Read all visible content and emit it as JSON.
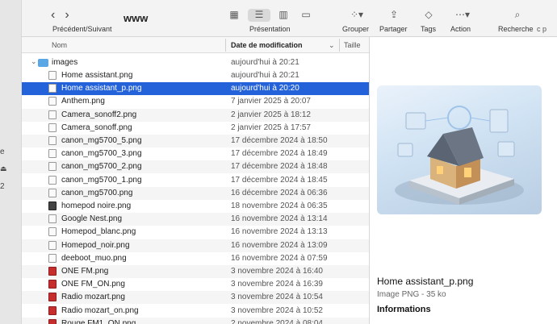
{
  "window_title": "www",
  "sidebar_fragments": [
    "e",
    "2"
  ],
  "toolbar": {
    "nav_label": "Précédent/Suivant",
    "back_glyph": "‹",
    "forward_glyph": "›",
    "view_label": "Présentation",
    "group_label": "Grouper",
    "share_label": "Partager",
    "tags_label": "Tags",
    "action_label": "Action",
    "search_label": "Recherche",
    "cut_label": "c p"
  },
  "columns": {
    "name": "Nom",
    "date": "Date de modification",
    "size": "Taille"
  },
  "folder": {
    "name": "images",
    "date": "aujourd'hui à 20:21"
  },
  "files": [
    {
      "name": "Home assistant.png",
      "date": "aujourd'hui à 20:21",
      "icon": "image"
    },
    {
      "name": "Home assistant_p.png",
      "date": "aujourd'hui à 20:20",
      "icon": "image",
      "selected": true
    },
    {
      "name": "Anthem.png",
      "date": "7 janvier 2025 à 20:07",
      "icon": "image"
    },
    {
      "name": "Camera_sonoff2.png",
      "date": "2 janvier 2025 à 18:12",
      "icon": "image"
    },
    {
      "name": "Camera_sonoff.png",
      "date": "2 janvier 2025 à 17:57",
      "icon": "image"
    },
    {
      "name": "canon_mg5700_5.png",
      "date": "17 décembre 2024 à 18:50",
      "icon": "image"
    },
    {
      "name": "canon_mg5700_3.png",
      "date": "17 décembre 2024 à 18:49",
      "icon": "image"
    },
    {
      "name": "canon_mg5700_2.png",
      "date": "17 décembre 2024 à 18:48",
      "icon": "image"
    },
    {
      "name": "canon_mg5700_1.png",
      "date": "17 décembre 2024 à 18:45",
      "icon": "image"
    },
    {
      "name": "canon_mg5700.png",
      "date": "16 décembre 2024 à 06:36",
      "icon": "image"
    },
    {
      "name": "homepod noire.png",
      "date": "18 novembre 2024 à 06:35",
      "icon": "dark"
    },
    {
      "name": "Google Nest.png",
      "date": "16 novembre 2024 à 13:14",
      "icon": "image"
    },
    {
      "name": "Homepod_blanc.png",
      "date": "16 novembre 2024 à 13:13",
      "icon": "image"
    },
    {
      "name": "Homepod_noir.png",
      "date": "16 novembre 2024 à 13:09",
      "icon": "image"
    },
    {
      "name": "deeboot_muo.png",
      "date": "16 novembre 2024 à 07:59",
      "icon": "image"
    },
    {
      "name": "ONE FM.png",
      "date": "3 novembre 2024 à 16:40",
      "icon": "red"
    },
    {
      "name": "ONE FM_ON.png",
      "date": "3 novembre 2024 à 16:39",
      "icon": "red"
    },
    {
      "name": "Radio mozart.png",
      "date": "3 novembre 2024 à 10:54",
      "icon": "red"
    },
    {
      "name": "Radio mozart_on.png",
      "date": "3 novembre 2024 à 10:52",
      "icon": "red"
    },
    {
      "name": "Rouge FM1_ON.png",
      "date": "2 novembre 2024 à 08:04",
      "icon": "red"
    }
  ],
  "preview": {
    "name": "Home assistant_p.png",
    "kind": "Image PNG - 35 ko",
    "info_heading": "Informations"
  },
  "colors": {
    "selection": "#2462d9",
    "folder": "#5aa7e6"
  }
}
